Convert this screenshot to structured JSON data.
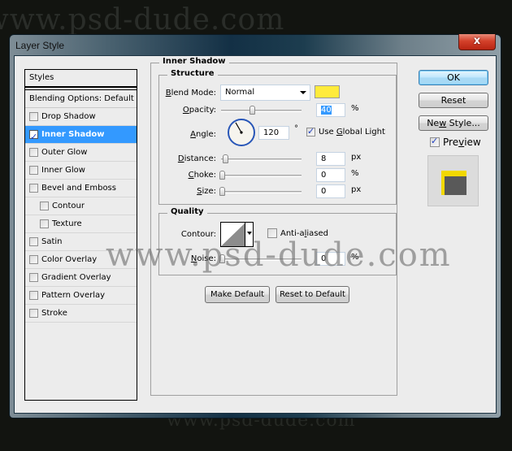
{
  "watermark": "www.psd-dude.com",
  "window": {
    "title": "Layer Style",
    "close_label": "x"
  },
  "styles_panel": {
    "header": "Styles",
    "blending_options": "Blending Options: Default",
    "items": [
      {
        "label": "Drop Shadow",
        "checked": false,
        "selected": false,
        "indent": false
      },
      {
        "label": "Inner Shadow",
        "checked": true,
        "selected": true,
        "indent": false
      },
      {
        "label": "Outer Glow",
        "checked": false,
        "selected": false,
        "indent": false
      },
      {
        "label": "Inner Glow",
        "checked": false,
        "selected": false,
        "indent": false
      },
      {
        "label": "Bevel and Emboss",
        "checked": false,
        "selected": false,
        "indent": false
      },
      {
        "label": "Contour",
        "checked": false,
        "selected": false,
        "indent": true
      },
      {
        "label": "Texture",
        "checked": false,
        "selected": false,
        "indent": true
      },
      {
        "label": "Satin",
        "checked": false,
        "selected": false,
        "indent": false
      },
      {
        "label": "Color Overlay",
        "checked": false,
        "selected": false,
        "indent": false
      },
      {
        "label": "Gradient Overlay",
        "checked": false,
        "selected": false,
        "indent": false
      },
      {
        "label": "Pattern Overlay",
        "checked": false,
        "selected": false,
        "indent": false
      },
      {
        "label": "Stroke",
        "checked": false,
        "selected": false,
        "indent": false
      }
    ]
  },
  "inner_shadow": {
    "title": "Inner Shadow",
    "structure": {
      "title": "Structure",
      "blend_mode_label_u": "B",
      "blend_mode_label_rest": "lend Mode:",
      "blend_mode_value": "Normal",
      "shadow_color": "#ffeb3b",
      "opacity_label_u": "O",
      "opacity_label_rest": "pacity:",
      "opacity_value": "40",
      "opacity_unit": "%",
      "opacity_fraction": 0.4,
      "angle_label_u": "A",
      "angle_label_rest": "ngle:",
      "angle_value": "120",
      "angle_unit": "°",
      "angle_degrees": 120,
      "use_global_light_pre": "Use ",
      "use_global_light_u": "G",
      "use_global_light_post": "lobal Light",
      "use_global_light_checked": true,
      "distance_label_u": "D",
      "distance_label_rest": "istance:",
      "distance_value": "8",
      "distance_unit": "px",
      "distance_fraction": 0.04,
      "choke_label_u": "C",
      "choke_label_rest": "hoke:",
      "choke_value": "0",
      "choke_unit": "%",
      "choke_fraction": 0,
      "size_label_u": "S",
      "size_label_rest": "ize:",
      "size_value": "0",
      "size_unit": "px",
      "size_fraction": 0
    },
    "quality": {
      "title": "Quality",
      "contour_label": "Contour:",
      "anti_aliased_pre": "Anti-a",
      "anti_aliased_u": "l",
      "anti_aliased_post": "iased",
      "anti_aliased_checked": false,
      "noise_label_u": "N",
      "noise_label_rest": "oise:",
      "noise_value": "0",
      "noise_unit": "%",
      "noise_fraction": 0
    },
    "make_default": "Make Default",
    "reset_to_default": "Reset to Default"
  },
  "actions": {
    "ok": "OK",
    "reset": "Reset",
    "new_style_pre": "Ne",
    "new_style_u": "w",
    "new_style_post": " Style...",
    "preview_pre": "Pre",
    "preview_u": "v",
    "preview_post": "iew",
    "preview_checked": true,
    "preview_colors": {
      "border": "#f2d800",
      "fill": "#595959"
    }
  }
}
